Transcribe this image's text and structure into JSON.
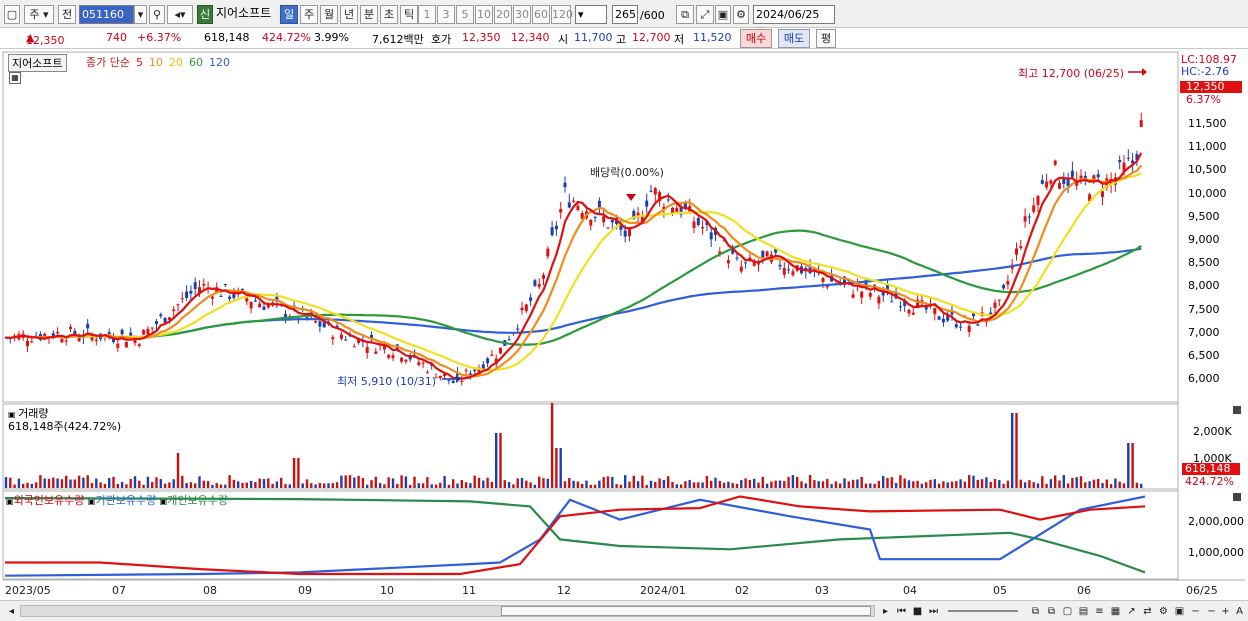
{
  "toolbar": {
    "period": "주",
    "prev": "전",
    "code": "051160",
    "new_badge": "신",
    "stock_name": "지어소프트",
    "tabs": [
      "일",
      "주",
      "월",
      "년",
      "분",
      "초",
      "틱"
    ],
    "active_tab": "일",
    "intervals": [
      "1",
      "3",
      "5",
      "10",
      "20",
      "30",
      "60",
      "120"
    ],
    "count": "265",
    "count_total": "/600",
    "date": "2024/06/25"
  },
  "info": {
    "price": "12,350",
    "change": "740",
    "change_pct": "+6.37%",
    "volume": "618,148",
    "vol_ratio": "424.72%",
    "turnover": "3.99%",
    "amount": "7,612백만",
    "bid_label": "호가",
    "bid1": "12,350",
    "bid2": "12,340",
    "open_label": "시",
    "open": "11,700",
    "high_label": "고",
    "high": "12,700",
    "low_label": "저",
    "low": "11,520",
    "buy_btn": "매수",
    "sell_btn": "매도",
    "avg_btn": "평"
  },
  "price_panel": {
    "title": "지어소프트",
    "legend_prefix": "종가 단순",
    "ma_periods": [
      "5",
      "10",
      "20",
      "60",
      "120"
    ],
    "ma_colors": [
      "#e01010",
      "#f08c1a",
      "#f0e020",
      "#2a9a3a",
      "#2f5fd8"
    ],
    "lc": "LC:108.97",
    "hc": "HC:-2.76",
    "current_tag": "12,350",
    "pct_tag": "6.37%",
    "high_note": "최고 12,700 (06/25)",
    "low_note": "최저 5,910 (10/31)",
    "dividend_note": "배당락(0.00%)",
    "y_ticks": [
      "11,500",
      "11,000",
      "10,500",
      "10,000",
      "9,500",
      "9,000",
      "8,500",
      "8,000",
      "7,500",
      "7,000",
      "6,500",
      "6,000"
    ]
  },
  "volume_panel": {
    "title": "거래량",
    "value": "618,148주(424.72%)",
    "y_ticks": [
      "2,000K",
      "1,000K"
    ],
    "current_tag": "618,148",
    "pct_tag": "424.72%"
  },
  "holdings_panel": {
    "legend": [
      "외국인보유수량",
      "기관보유수량",
      "개인보유수량"
    ],
    "legend_colors": [
      "#d0021b",
      "#2f5fd8",
      "#2a8a4a"
    ],
    "y_ticks": [
      "2,000,000",
      "1,000,000"
    ]
  },
  "x_axis": [
    "2023/05",
    "07",
    "08",
    "09",
    "10",
    "11",
    "12",
    "2024/01",
    "02",
    "03",
    "04",
    "05",
    "06",
    "06/25"
  ]
}
